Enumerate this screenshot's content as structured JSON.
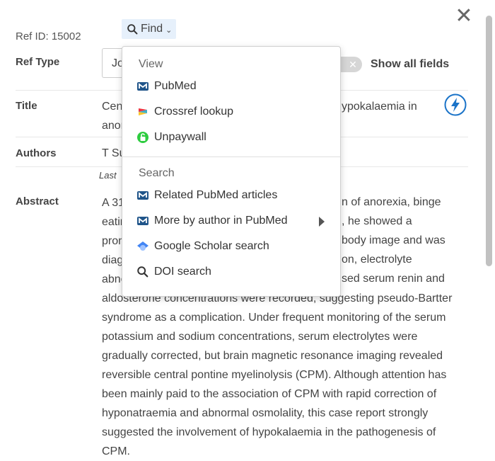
{
  "ref": {
    "id_label": "Ref ID: 15002"
  },
  "find_button": {
    "label": "Find"
  },
  "fields": {
    "ref_type": {
      "label": "Ref Type",
      "value_partial": "Jo"
    },
    "show_all_fields": "Show all fields",
    "title": {
      "label": "Title",
      "line1_start": "Cent",
      "line1_end": "ypokalaemia in",
      "line2_start": "anor"
    },
    "authors": {
      "label": "Authors",
      "value_partial": "T Su",
      "sub_partial": "Last"
    },
    "abstract": {
      "label": "Abstract",
      "lines": [
        "A 31",
        "eatin",
        "prom",
        "diag",
        "abno",
        "aldosterone concentrations were recorded, suggesting pseudo-Bartter",
        "syndrome as a complication. Under frequent monitoring of the serum",
        "potassium and sodium concentrations, serum electrolytes were",
        "gradually corrected, but brain magnetic resonance imaging revealed",
        "reversible central pontine myelinolysis (CPM). Although attention has",
        "been mainly paid to the association of CPM with rapid correction of",
        "hyponatraemia and abnormal osmolality, this case report strongly",
        "suggested the involvement of hypokalaemia in the pathogenesis of",
        "CPM."
      ],
      "right_fragments": [
        "n of anorexia, binge",
        ", he showed a",
        "body image and was",
        "on, electrolyte",
        "sed serum renin and"
      ]
    }
  },
  "dropdown": {
    "view_header": "View",
    "view_items": [
      {
        "label": "PubMed",
        "icon": "pubmed-icon"
      },
      {
        "label": "Crossref lookup",
        "icon": "crossref-icon"
      },
      {
        "label": "Unpaywall",
        "icon": "unpaywall-icon"
      }
    ],
    "search_header": "Search",
    "search_items": [
      {
        "label": "Related PubMed articles",
        "icon": "pubmed-icon"
      },
      {
        "label": "More by author in PubMed",
        "icon": "pubmed-icon",
        "has_submenu": true
      },
      {
        "label": "Google Scholar search",
        "icon": "google-scholar-icon"
      },
      {
        "label": "DOI search",
        "icon": "search-icon"
      }
    ]
  },
  "colors": {
    "accent_blue": "#1a73c8",
    "find_bg": "#e6f0fb",
    "unpaywall_green": "#2ecc40"
  }
}
